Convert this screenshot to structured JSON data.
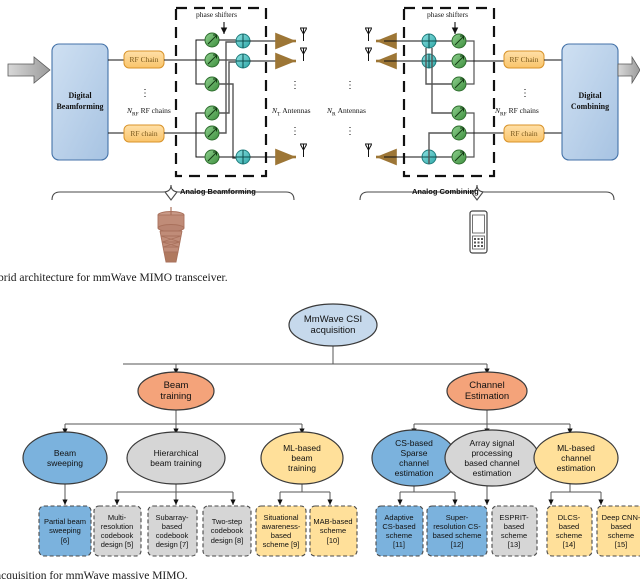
{
  "figure1": {
    "caption": "brid architecture for mmWave MIMO transceiver.",
    "tx": {
      "digital_block_label_line1": "Digital",
      "digital_block_label_line2": "Beamforming",
      "rf_chain_top": "RF Chain",
      "rf_chain_bottom": "RF chain",
      "rf_chains_count": "N",
      "rf_chains_sub": "RF",
      "rf_chains_text": "RF chains",
      "phase_shifters_label": "phase shifters",
      "antennas_count": "N",
      "antennas_sub": "T",
      "antennas_text": "Antennas",
      "analog_label": "Analog Beamforming",
      "vdots": "⋮"
    },
    "rx": {
      "digital_block_label_line1": "Digital",
      "digital_block_label_line2": "Combining",
      "rf_chain_top": "RF Chain",
      "rf_chain_bottom": "RF chain",
      "rf_chains_count": "N",
      "rf_chains_sub": "RF",
      "rf_chains_text": "RF chains",
      "phase_shifters_label": "phase shifters",
      "antennas_count": "N",
      "antennas_sub": "R",
      "antennas_text": "Antennas",
      "analog_label": "Analog Combining",
      "vdots": "⋮"
    },
    "icons": {
      "base_station": "tower-icon",
      "user_equipment": "mobile-phone-icon",
      "input_arrow": "input-arrow-icon",
      "output_arrow": "output-arrow-icon"
    },
    "colors": {
      "digital_block_fill": "#b8cce4",
      "digital_block_stroke": "#4472a8",
      "rf_chain_fill": "#fcd28c",
      "rf_chain_stroke": "#d8932a",
      "phase_shifter_fill": "#66b266",
      "phase_shifter_stroke": "#2f6e2f",
      "combiner_fill": "#56c8c8",
      "combiner_stroke": "#1f7d7d",
      "antenna_fill": "#a0793c",
      "tower_color": "#a9715c"
    }
  },
  "figure2": {
    "caption": "acquisition for mmWave massive MIMO.",
    "root": {
      "line1": "MmWave CSI",
      "line2": "acquisition",
      "fill": "#c6d9ec"
    },
    "level2": [
      {
        "line1": "Beam",
        "line2": "training",
        "fill": "#f4a37a"
      },
      {
        "line1": "Channel",
        "line2": "Estimation",
        "fill": "#f4a37a"
      }
    ],
    "level3": [
      {
        "lines": [
          "Beam",
          "sweeping"
        ],
        "fill": "#7bb2dd"
      },
      {
        "lines": [
          "Hierarchical",
          "beam training"
        ],
        "fill": "#d6d6d6"
      },
      {
        "lines": [
          "ML-based",
          "beam",
          "training"
        ],
        "fill": "#ffe09a"
      },
      {
        "lines": [
          "CS-based",
          "Sparse",
          "channel",
          "estimation"
        ],
        "fill": "#7bb2dd"
      },
      {
        "lines": [
          "Array signal",
          "processing",
          "based channel",
          "estimation"
        ],
        "fill": "#d6d6d6"
      },
      {
        "lines": [
          "ML-based",
          "channel",
          "estimation"
        ],
        "fill": "#ffe09a"
      }
    ],
    "leaves": [
      {
        "lines": [
          "Partial beam",
          "sweeping",
          "[6]"
        ],
        "fill": "#7bb2dd"
      },
      {
        "lines": [
          "Multi-",
          "resolution",
          "codebook",
          "design [5]"
        ],
        "fill": "#d6d6d6"
      },
      {
        "lines": [
          "Subarray-",
          "based",
          "codebook",
          "design [7]"
        ],
        "fill": "#d6d6d6"
      },
      {
        "lines": [
          "Two-step",
          "codebook",
          "design [8]"
        ],
        "fill": "#d6d6d6"
      },
      {
        "lines": [
          "Situational",
          "awareness-",
          "based",
          "scheme [9]"
        ],
        "fill": "#ffe09a"
      },
      {
        "lines": [
          "MAB-based",
          "scheme",
          "[10]"
        ],
        "fill": "#ffe09a"
      },
      {
        "lines": [
          "Adaptive",
          "CS-based",
          "scheme",
          "[11]"
        ],
        "fill": "#7bb2dd"
      },
      {
        "lines": [
          "Super-",
          "resolution CS-",
          "based scheme",
          "[12]"
        ],
        "fill": "#7bb2dd"
      },
      {
        "lines": [
          "ESPRIT-",
          "based",
          "scheme",
          "[13]"
        ],
        "fill": "#d6d6d6"
      },
      {
        "lines": [
          "DLCS-",
          "based",
          "scheme",
          "[14]"
        ],
        "fill": "#ffe09a"
      },
      {
        "lines": [
          "Deep CNN-",
          "based",
          "scheme",
          "[15]"
        ],
        "fill": "#ffe09a"
      }
    ]
  }
}
